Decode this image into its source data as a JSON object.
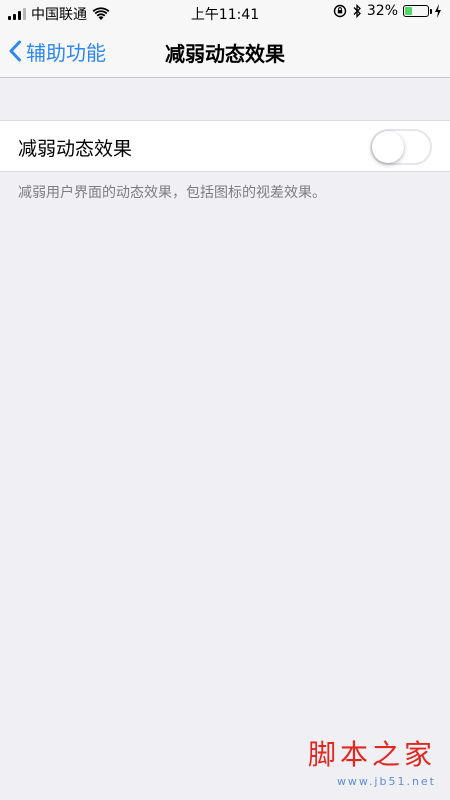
{
  "status_bar": {
    "carrier": "中国联通",
    "time": "上午11:41",
    "battery_percent": "32%",
    "battery_level": 0.32,
    "battery_color": "#4cd964"
  },
  "nav": {
    "back_label": "辅助功能",
    "title": "减弱动态效果",
    "accent": "#2f87f0"
  },
  "setting": {
    "label": "减弱动态效果",
    "enabled": false,
    "footer": "减弱用户界面的动态效果，包括图标的视差效果。"
  },
  "watermark": {
    "main": "脚本之家",
    "sub": "www.jb51.net"
  }
}
